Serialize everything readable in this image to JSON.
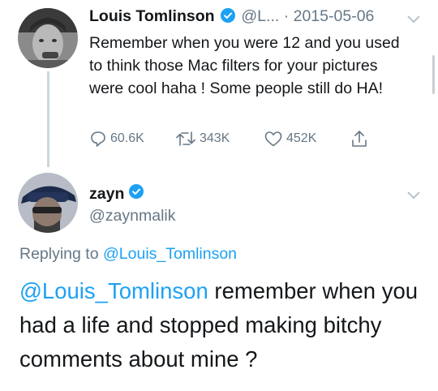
{
  "tweet1": {
    "name": "Louis Tomlinson",
    "handle_truncated": "@L...",
    "separator": "·",
    "date": "2015-05-06",
    "text": "Remember when you were 12 and you used to think those Mac filters for your pictures were cool haha ! Some people still do HA!",
    "actions": {
      "replies": "60.6K",
      "retweets": "343K",
      "likes": "452K"
    }
  },
  "tweet2": {
    "name": "zayn",
    "handle": "@zaynmalik",
    "replying_prefix": "Replying to",
    "replying_to": "@Louis_Tomlinson",
    "mention": "@Louis_Tomlinson",
    "text": " remember when you had a life and stopped making bitchy comments about mine ?"
  },
  "colors": {
    "accent": "#1da1f2",
    "muted": "#657786",
    "verified": "#1da1f2",
    "thread_line": "#ccd6dd"
  },
  "icons": [
    "verified-badge-icon",
    "chevron-down-icon",
    "reply-icon",
    "retweet-icon",
    "like-icon",
    "share-icon"
  ]
}
